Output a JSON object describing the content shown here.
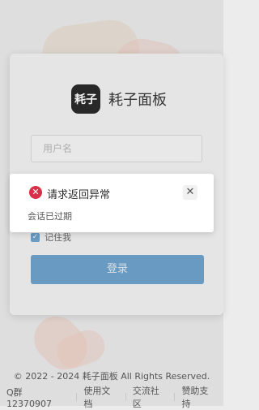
{
  "brand": {
    "logo_text": "耗子",
    "app_name": "耗子面板"
  },
  "login": {
    "username_placeholder": "用户名",
    "remember_label": "记住我",
    "remember_checked": true,
    "submit_label": "登录"
  },
  "dialog": {
    "title": "请求返回异常",
    "message": "会话已过期",
    "error_color": "#d9304a"
  },
  "footer": {
    "copyright": "© 2022 - 2024 耗子面板 All Rights Reserved.",
    "links": [
      "Q群 12370907",
      "使用文档",
      "交流社区",
      "赞助支持"
    ]
  },
  "colors": {
    "accent": "#6fa4cf"
  }
}
